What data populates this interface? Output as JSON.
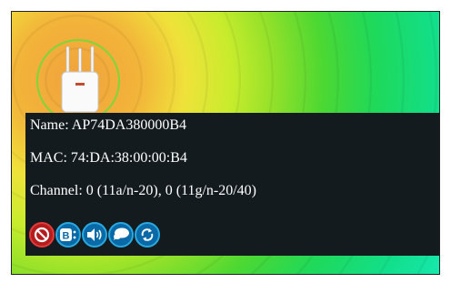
{
  "access_point": {
    "name_label": "Name: ",
    "name_value": "AP74DA380000B4",
    "mac_label": "MAC: ",
    "mac_value": "74:DA:38:00:00:B4",
    "channel_label": "Channel: ",
    "channel_value": "0 (11a/n-20), 0 (11g/n-20/40)"
  },
  "actions": [
    {
      "icon": "block-icon"
    },
    {
      "icon": "bluetooth-icon"
    },
    {
      "icon": "speaker-icon"
    },
    {
      "icon": "chat-icon"
    },
    {
      "icon": "refresh-icon"
    }
  ],
  "colors": {
    "panel_bg": "#141b1e",
    "action_blue": "#0a6aa8",
    "action_red": "#b51c1c",
    "marker_ring": "#7dd63a"
  }
}
